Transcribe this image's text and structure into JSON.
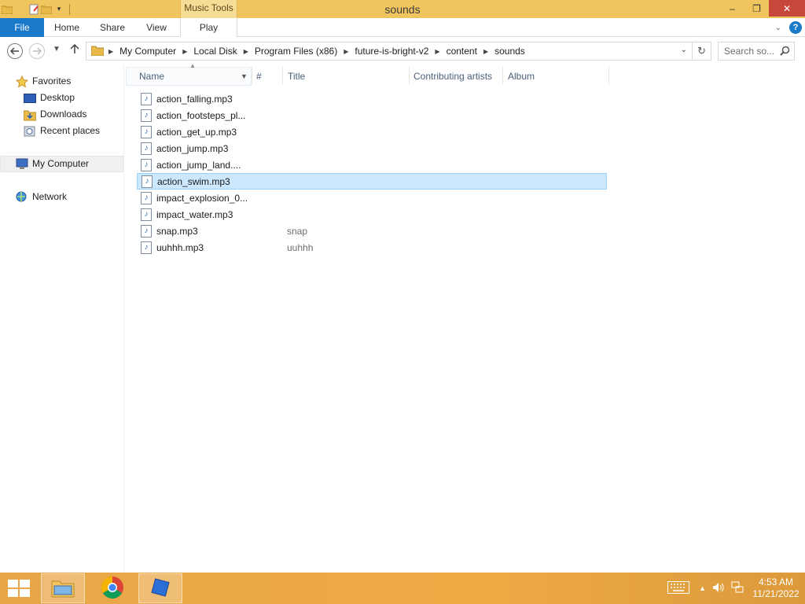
{
  "window": {
    "title": "sounds",
    "context_tab_header": "Music Tools",
    "buttons": {
      "minimize": "–",
      "restore": "❐",
      "close": "✕"
    }
  },
  "ribbon": {
    "tabs": [
      "File",
      "Home",
      "Share",
      "View",
      "Play"
    ]
  },
  "address": {
    "crumbs": [
      "My Computer",
      "Local Disk",
      "Program Files (x86)",
      "future-is-bright-v2",
      "content",
      "sounds"
    ],
    "search_placeholder": "Search so..."
  },
  "nav_pane": {
    "favorites_label": "Favorites",
    "favorites": [
      "Desktop",
      "Downloads",
      "Recent places"
    ],
    "my_computer": "My Computer",
    "network": "Network"
  },
  "columns": {
    "name": "Name",
    "number": "#",
    "title": "Title",
    "contributing_artists": "Contributing artists",
    "album": "Album"
  },
  "files": [
    {
      "name": "action_falling.mp3",
      "title": ""
    },
    {
      "name": "action_footsteps_pl...",
      "title": ""
    },
    {
      "name": "action_get_up.mp3",
      "title": ""
    },
    {
      "name": "action_jump.mp3",
      "title": ""
    },
    {
      "name": "action_jump_land....",
      "title": ""
    },
    {
      "name": "action_swim.mp3",
      "title": "",
      "selected": true
    },
    {
      "name": "impact_explosion_0...",
      "title": ""
    },
    {
      "name": "impact_water.mp3",
      "title": ""
    },
    {
      "name": "snap.mp3",
      "title": "snap"
    },
    {
      "name": "uuhhh.mp3",
      "title": "uuhhh"
    }
  ],
  "taskbar": {
    "time": "4:53 AM",
    "date": "11/21/2022"
  }
}
